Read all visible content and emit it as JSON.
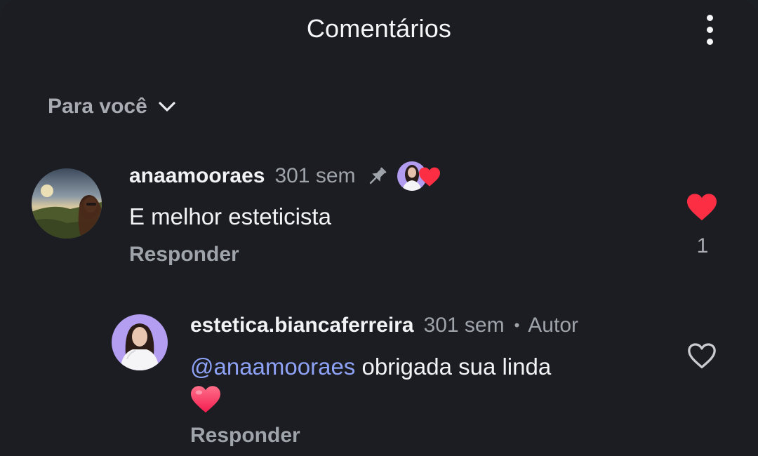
{
  "header": {
    "title": "Comentários",
    "more_icon": "more-vertical-icon"
  },
  "sort": {
    "label": "Para você",
    "icon": "chevron-down-icon"
  },
  "comments": [
    {
      "username": "anaamooraes",
      "time": "301 sem",
      "pinned": true,
      "liked_by_author": true,
      "text": "E melhor esteticista",
      "reply_label": "Responder",
      "liked": true,
      "like_count": "1"
    }
  ],
  "reply": {
    "username": "estetica.biancaferreira",
    "time": "301 sem",
    "separator": "•",
    "author_label": "Autor",
    "mention": "@anaamooraes",
    "text": " obrigada sua linda",
    "emoji": "heart-emoji",
    "reply_label": "Responder",
    "liked": false
  },
  "colors": {
    "background": "#1b1d22",
    "heart_red": "#fb2e44",
    "mention_blue": "#8ea2f5",
    "muted_text": "#9fa3aa"
  }
}
